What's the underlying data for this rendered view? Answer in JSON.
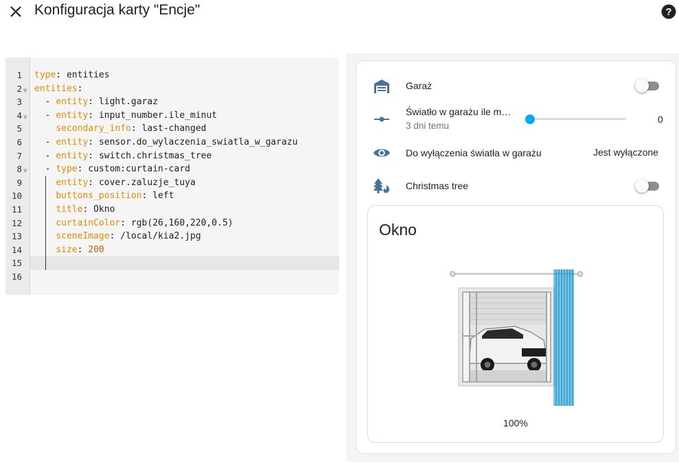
{
  "header": {
    "title": "Konfiguracja karty \"Encje\"",
    "close_icon": "close-icon",
    "help_icon": "help-circle-icon"
  },
  "editor": {
    "line_numbers": [
      "1",
      "2",
      "3",
      "4",
      "5",
      "6",
      "7",
      "8",
      "9",
      "10",
      "11",
      "12",
      "13",
      "14",
      "15",
      "16"
    ],
    "fold_markers": {
      "2": "v",
      "4": "v",
      "8": "v"
    },
    "lines": [
      {
        "indent": "",
        "key": "type",
        "sep": ": ",
        "value": "entities"
      },
      {
        "indent": "",
        "key": "entities",
        "sep": ":",
        "value": ""
      },
      {
        "indent": "  - ",
        "key": "entity",
        "sep": ": ",
        "value": "light.garaz"
      },
      {
        "indent": "  - ",
        "key": "entity",
        "sep": ": ",
        "value": "input_number.ile_minut"
      },
      {
        "indent": "    ",
        "key": "secondary_info",
        "sep": ": ",
        "value": "last-changed"
      },
      {
        "indent": "  - ",
        "key": "entity",
        "sep": ": ",
        "value": "sensor.do_wylaczenia_swiatla_w_garazu"
      },
      {
        "indent": "  - ",
        "key": "entity",
        "sep": ": ",
        "value": "switch.christmas_tree"
      },
      {
        "indent": "  - ",
        "key": "type",
        "sep": ": ",
        "value": "custom:curtain-card"
      },
      {
        "indent": "    ",
        "key": "entity",
        "sep": ": ",
        "value": "cover.zaluzje_tuya"
      },
      {
        "indent": "    ",
        "key": "buttons_position",
        "sep": ": ",
        "value": "left"
      },
      {
        "indent": "    ",
        "key": "title",
        "sep": ": ",
        "value": "Okno"
      },
      {
        "indent": "    ",
        "key": "curtainColor",
        "sep": ": ",
        "value": "rgb(26,160,220,0.5)"
      },
      {
        "indent": "    ",
        "key": "sceneImage",
        "sep": ": ",
        "value": "/local/kia2.jpg"
      },
      {
        "indent": "    ",
        "key": "size",
        "sep": ": ",
        "value": "200",
        "numeric": true
      },
      {
        "indent": "",
        "key": "",
        "sep": "",
        "value": ""
      },
      {
        "indent": "",
        "key": "",
        "sep": "",
        "value": ""
      }
    ],
    "colors": {
      "key": "#e58a00",
      "number": "#b26600"
    }
  },
  "preview": {
    "rows": [
      {
        "name": "Garaż",
        "icon": "garage-icon",
        "control": "toggle",
        "state": "off"
      },
      {
        "name": "Światło w garażu ile m…",
        "secondary": "3 dni temu",
        "icon": "slider-icon",
        "control": "slider",
        "value": "0",
        "fraction": 0
      },
      {
        "name": "Do wyłączenia światła w garażu",
        "icon": "eye-icon",
        "state_text": "Jest wyłączone"
      },
      {
        "name": "Christmas tree",
        "icon": "pine-tree-fire-icon",
        "control": "toggle",
        "state": "off"
      }
    ],
    "curtain_card": {
      "title": "Okno",
      "position": "100%",
      "curtain_color": "#1aa0dc",
      "scene_icon": "car-scene-image"
    }
  }
}
